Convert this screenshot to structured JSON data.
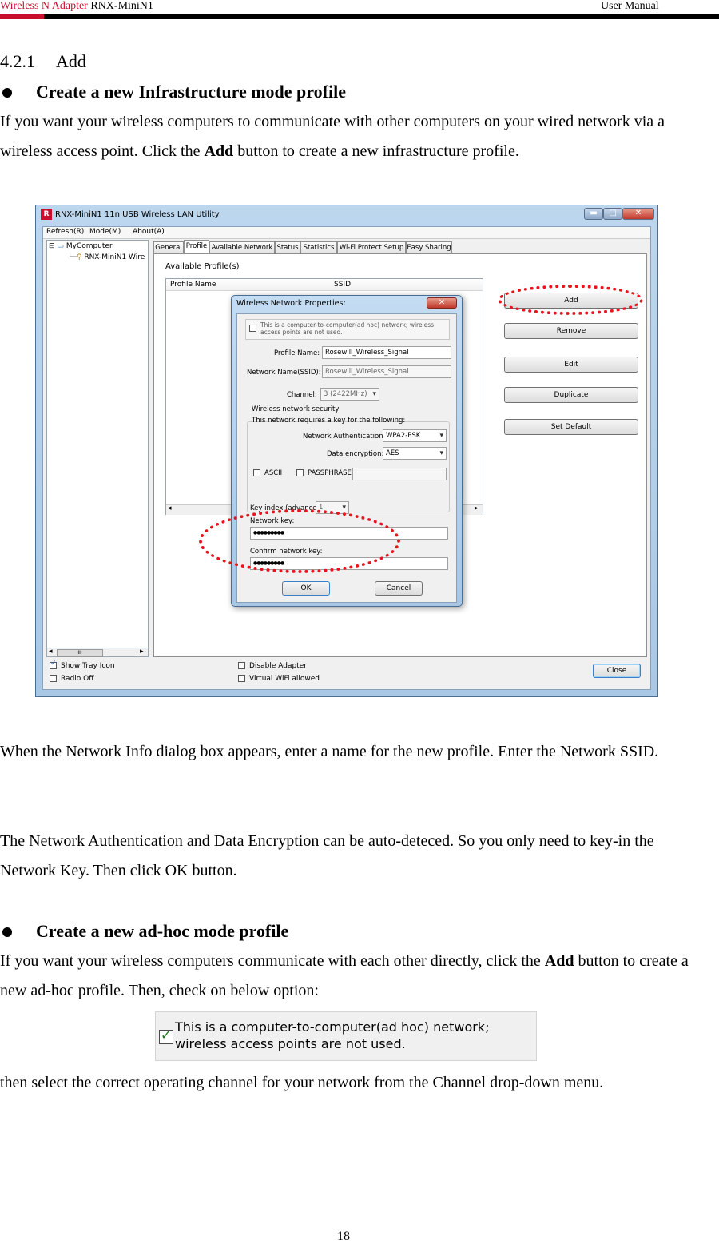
{
  "header": {
    "product_red": "Wireless N Adapter",
    "product_black": "RNX-MiniN1",
    "right": "User Manual"
  },
  "section": {
    "number": "4.2.1",
    "title": "Add"
  },
  "bullet1": {
    "heading": "Create a new Infrastructure mode profile",
    "para_pre": "If you want your wireless computers to communicate with other computers on your wired network via a wireless access point. Click the ",
    "para_bold": "Add",
    "para_post": " button to create a new infrastructure profile."
  },
  "screenshot": {
    "window_title": "RNX-MiniN1 11n USB Wireless LAN Utility",
    "app_icon_letter": "R",
    "minimize": "▬",
    "maximize": "□",
    "close": "✕",
    "menu": [
      "Refresh(R)",
      "Mode(M)",
      "About(A)"
    ],
    "tree": {
      "root": "MyComputer",
      "child": "RNX-MiniN1 Wire",
      "expander": "⊟",
      "scroll_left": "◂",
      "scroll_thumb": "III",
      "scroll_right": "▸"
    },
    "tabs": [
      "General",
      "Profile",
      "Available Network",
      "Status",
      "Statistics",
      "Wi-Fi Protect Setup",
      "Easy Sharing"
    ],
    "available_profiles_label": "Available Profile(s)",
    "columns": [
      "Profile Name",
      "SSID"
    ],
    "buttons": [
      "Add",
      "Remove",
      "Edit",
      "Duplicate",
      "Set Default"
    ],
    "bottom": {
      "show_tray_icon": "Show Tray Icon",
      "radio_off": "Radio Off",
      "disable_adapter": "Disable Adapter",
      "virtual_wifi": "Virtual WiFi allowed",
      "close_button": "Close"
    },
    "dialog": {
      "title": "Wireless Network Properties:",
      "close": "✕",
      "adhoc_text": "This is a computer-to-computer(ad hoc) network; wireless access points are not used.",
      "profile_name_label": "Profile Name:",
      "profile_name_value": "Rosewill_Wireless_Signal",
      "ssid_label": "Network Name(SSID):",
      "ssid_value": "Rosewill_Wireless_Signal",
      "channel_label": "Channel:",
      "channel_value": "3  (2422MHz)",
      "security_group": "Wireless network security",
      "security_desc": "This network requires a key for the following:",
      "auth_label": "Network Authentication:",
      "auth_value": "WPA2-PSK",
      "enc_label": "Data encryption:",
      "enc_value": "AES",
      "ascii": "ASCII",
      "passphrase": "PASSPHRASE",
      "key_index_label": "Key index (advanced):",
      "key_index_value": "1",
      "network_key_label": "Network key:",
      "network_key_value": "●●●●●●●●●",
      "confirm_key_label": "Confirm network key:",
      "confirm_key_value": "●●●●●●●●●",
      "ok": "OK",
      "cancel": "Cancel"
    }
  },
  "para2": "When the Network Info dialog box appears, enter a name for the new profile. Enter the Network SSID.",
  "para3": "The Network Authentication and Data Encryption can be auto-deteced. So you only need to key-in the Network Key. Then click OK button.",
  "bullet2": {
    "heading": "Create a new ad-hoc mode profile",
    "para_pre": "If you want your wireless computers communicate with each other directly, click the ",
    "para_bold": "Add",
    "para_post": " button to create a new ad-hoc profile. Then, check on below option:"
  },
  "snippet_text": "This is a computer-to-computer(ad hoc) network; wireless access points are not used.",
  "para4": "then select the correct operating channel for your network from the Channel drop-down menu.",
  "page_number": "18"
}
